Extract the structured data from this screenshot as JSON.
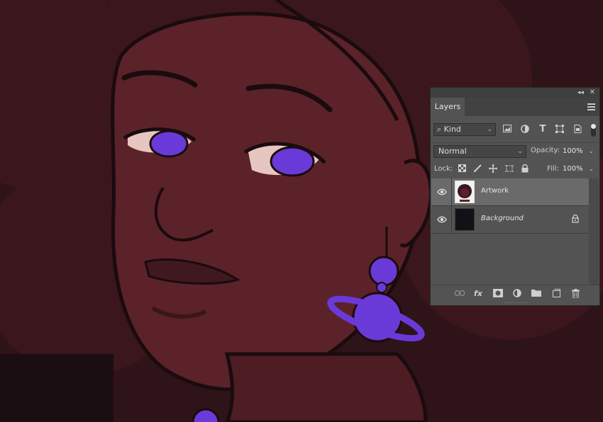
{
  "panel": {
    "tab_label": "Layers",
    "collapse_glyph": "◂◂",
    "close_glyph": "✕",
    "filter": {
      "kind_label": "Kind",
      "search_glyph": "⌕"
    },
    "blend_mode": "Normal",
    "opacity_label": "Opacity:",
    "opacity_value": "100%",
    "lock_label": "Lock:",
    "fill_label": "Fill:",
    "fill_value": "100%",
    "bottom_fx": "fx",
    "layers": [
      {
        "name": "Artwork",
        "visible": true,
        "selected": true,
        "locked": false
      },
      {
        "name": "Background",
        "visible": true,
        "selected": false,
        "locked": true
      }
    ]
  },
  "colors": {
    "canvas_bg": "#2a1217",
    "skin": "#5a2229",
    "hair": "#3a161b",
    "iris": "#6a3ad8",
    "panel_bg": "#535353",
    "selected_row": "#6a6a6a"
  }
}
